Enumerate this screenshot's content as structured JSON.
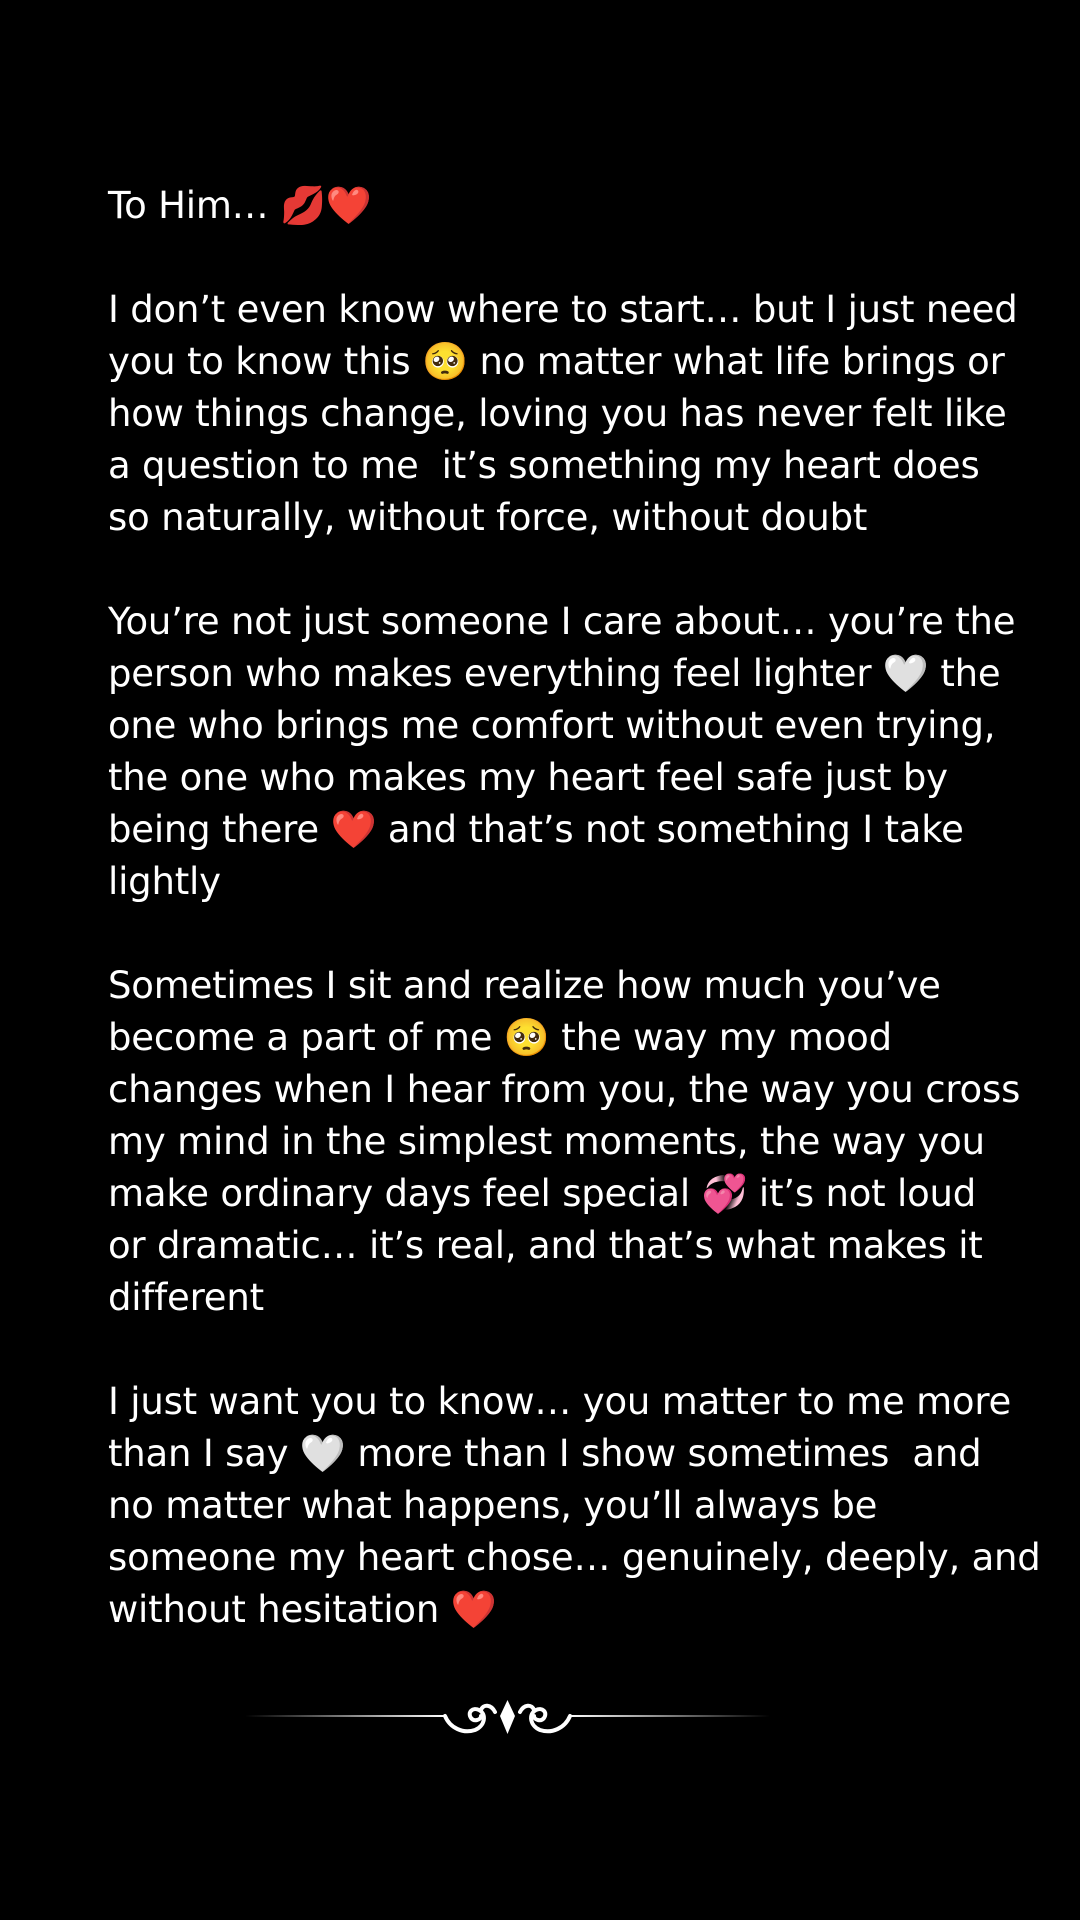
{
  "letter": {
    "greeting": "To Him… 💋❤️",
    "paragraphs": [
      {
        "lines": [
          "I don’t even know where to start… but I just need",
          "you to know this 🥺 no matter what life brings or",
          "how things change, loving you has never felt like",
          "a question to me  it’s something my heart does",
          "so naturally, without force, without doubt"
        ]
      },
      {
        "lines": [
          "You’re not just someone I care about… you’re the",
          "person who makes everything feel lighter 🤍 the",
          "one who brings me comfort without even trying,",
          "the one who makes my heart feel safe just by",
          "being there ❤️ and that’s not something I take",
          "lightly"
        ]
      },
      {
        "lines": [
          "Sometimes I sit and realize how much you’ve",
          "become a part of me 🥺 the way my mood",
          "changes when I hear from you, the way you cross",
          "my mind in the simplest moments, the way you",
          "make ordinary days feel special 💞 it’s not loud",
          "or dramatic… it’s real, and that’s what makes it",
          "different"
        ]
      },
      {
        "lines": [
          "I just want you to know… you matter to me more",
          "than I say 🤍 more than I show sometimes  and",
          "no matter what happens, you’ll always be",
          "someone my heart chose… genuinely, deeply, and",
          "without hesitation ❤️"
        ]
      }
    ]
  },
  "theme": {
    "background": "#000000",
    "text": "#ffffff"
  },
  "divider": {
    "icon": "ornamental-scroll-divider"
  }
}
